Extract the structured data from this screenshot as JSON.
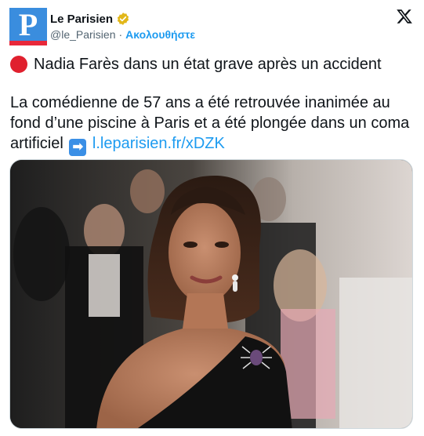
{
  "account": {
    "name": "Le Parisien",
    "handle": "@le_Parisien",
    "separator": "·",
    "follow_label": "Ακολουθήστε",
    "avatar_letter": "P",
    "verified_color": "#e2b719"
  },
  "post": {
    "headline": "Nadia Farès dans un état grave après un accident",
    "body": "La comédienne de 57 ans a été retrouvée inanimée au fond d’une piscine à Paris et a été plongée dans un coma artificiel",
    "arrow_glyph": "➡",
    "link_text": "l.leparisien.fr/xDZK"
  },
  "icons": {
    "platform": "x-logo-icon",
    "status": "red-circle-icon",
    "arrow": "right-arrow-icon",
    "verified": "verified-badge-icon"
  },
  "colors": {
    "accent_blue": "#1d9bf0",
    "brand_blue": "#3a8dde",
    "brand_red": "#e8283a"
  }
}
